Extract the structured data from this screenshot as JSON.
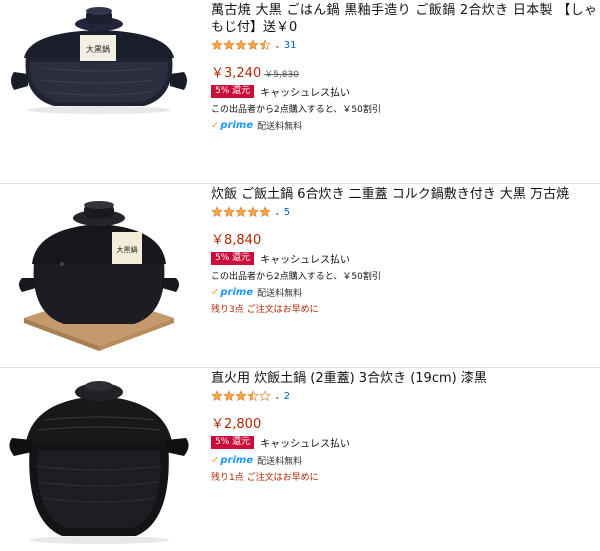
{
  "products": [
    {
      "title": "萬古焼 大黒 ごはん鍋 黒釉手造り ご飯鍋 2合炊き 日本製 【しゃもじ付】送￥0",
      "stars": 4.5,
      "review_count": "31",
      "price": "￥3,240",
      "old_price": "￥5,830",
      "badge": "5% 還元",
      "cashless": "キャッシュレス払い",
      "discount_note": "この出品者から2点購入すると、￥50割引",
      "prime": "prime",
      "shipping": "配送料無料",
      "image_label": "大黒鍋"
    },
    {
      "title": "炊飯 ご飯土鍋 6合炊き 二重蓋 コルク鍋敷き付き 大黒 万古焼",
      "stars": 5,
      "review_count": "5",
      "price": "￥8,840",
      "badge": "5% 還元",
      "cashless": "キャッシュレス払い",
      "discount_note": "この出品者から2点購入すると、￥50割引",
      "prime": "prime",
      "shipping": "配送料無料",
      "stock": "残り3点 ご注文はお早めに",
      "image_label": "大黒鍋"
    },
    {
      "title": "直火用 炊飯土鍋 (2重蓋) 3合炊き (19cm) 漆黒",
      "stars": 3.5,
      "review_count": "2",
      "price": "￥2,800",
      "badge": "5% 還元",
      "cashless": "キャッシュレス払い",
      "prime": "prime",
      "shipping": "配送料無料",
      "stock": "残り1点 ご注文はお早めに"
    }
  ],
  "colors": {
    "price": "#b12704",
    "link": "#0066c0",
    "star": "#f3a847",
    "badge": "#cc0c39",
    "prime_blue": "#1a98ff"
  },
  "icons": [
    "star-icon",
    "chevron-down-icon",
    "prime-check-icon"
  ]
}
